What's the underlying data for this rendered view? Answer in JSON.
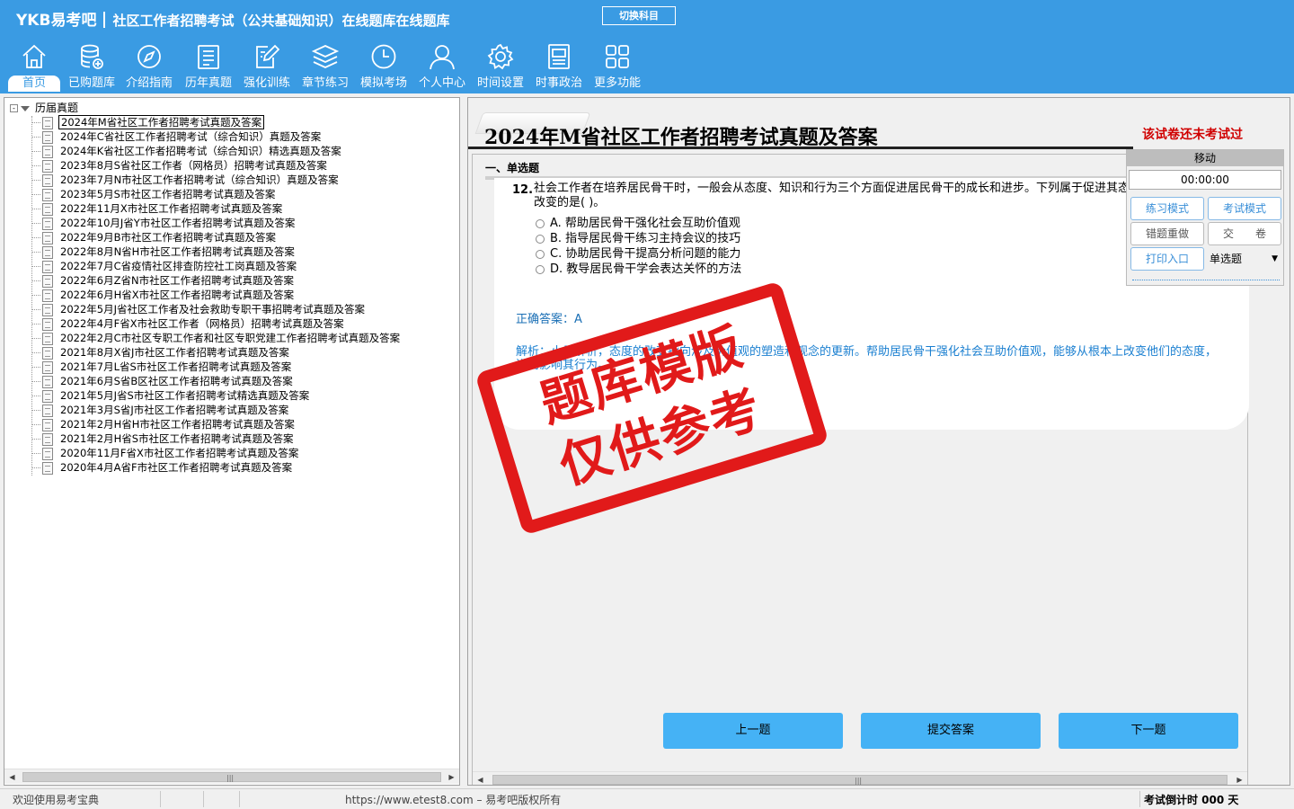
{
  "header": {
    "brand": "YKB易考吧",
    "app_title": "社区工作者招聘考试（公共基础知识）在线题库在线题库",
    "switch_subject_label": "切换科目"
  },
  "nav": [
    {
      "label": "首页",
      "icon": "home-icon"
    },
    {
      "label": "已购题库",
      "icon": "database-icon"
    },
    {
      "label": "介绍指南",
      "icon": "compass-icon"
    },
    {
      "label": "历年真题",
      "icon": "list-doc-icon"
    },
    {
      "label": "强化训练",
      "icon": "edit-icon"
    },
    {
      "label": "章节练习",
      "icon": "layers-icon"
    },
    {
      "label": "模拟考场",
      "icon": "clock-icon"
    },
    {
      "label": "个人中心",
      "icon": "user-icon"
    },
    {
      "label": "时间设置",
      "icon": "gear-icon"
    },
    {
      "label": "时事政治",
      "icon": "news-icon"
    },
    {
      "label": "更多功能",
      "icon": "grid-icon"
    }
  ],
  "tree": {
    "root_label": "历届真题",
    "expander": "-",
    "items": [
      "2024年M省社区工作者招聘考试真题及答案",
      "2024年C省社区工作者招聘考试（综合知识）真题及答案",
      "2024年K省社区工作者招聘考试（综合知识）精选真题及答案",
      "2023年8月S省社区工作者（网格员）招聘考试真题及答案",
      "2023年7月N市社区工作者招聘考试（综合知识）真题及答案",
      "2023年5月S市社区工作者招聘考试真题及答案",
      "2022年11月X市社区工作者招聘考试真题及答案",
      "2022年10月J省Y市社区工作者招聘考试真题及答案",
      "2022年9月B市社区工作者招聘考试真题及答案",
      "2022年8月N省H市社区工作者招聘考试真题及答案",
      "2022年7月C省疫情社区排查防控社工岗真题及答案",
      "2022年6月Z省N市社区工作者招聘考试真题及答案",
      "2022年6月H省X市社区工作者招聘考试真题及答案",
      "2022年5月J省社区工作者及社会救助专职干事招聘考试真题及答案",
      "2022年4月F省X市社区工作者（网格员）招聘考试真题及答案",
      "2022年2月C市社区专职工作者和社区专职党建工作者招聘考试真题及答案",
      "2021年8月X省J市社区工作者招聘考试真题及答案",
      "2021年7月L省S市社区工作者招聘考试真题及答案",
      "2021年6月S省B区社区工作者招聘考试真题及答案",
      "2021年5月J省S市社区工作者招聘考试精选真题及答案",
      "2021年3月S省J市社区工作者招聘考试真题及答案",
      "2021年2月H省H市社区工作者招聘考试真题及答案",
      "2021年2月H省S市社区工作者招聘考试真题及答案",
      "2020年11月F省X市社区工作者招聘考试真题及答案",
      "2020年4月A省F市社区工作者招聘考试真题及答案"
    ]
  },
  "paper": {
    "title": "2024年M省社区工作者招聘考试真题及答案",
    "status": "该试卷还未考试过",
    "section": "一、单选题",
    "question": {
      "number": "12.",
      "text": "社会工作者在培养居民骨干时，一般会从态度、知识和行为三个方面促进居民骨干的成长和进步。下列属于促进其态度改变的是( )。",
      "options": [
        "A. 帮助居民骨干强化社会互助价值观",
        "B. 指导居民骨干练习主持会议的技巧",
        "C. 协助居民骨干提高分析问题的能力",
        "D. 教导居民骨干学会表达关怀的方法"
      ],
      "answer": "正确答案：A",
      "analysis": "解析：小易解析，态度的改变指向涉及价值观的塑造和观念的更新。帮助居民骨干强化社会互助价值观，能够从根本上改变他们的态度，进而影响其行为。"
    }
  },
  "control": {
    "move_label": "移动",
    "timer": "00:00:00",
    "practice_mode": "练习模式",
    "exam_mode": "考试模式",
    "redo_wrong": "错题重做",
    "submit_paper": "交　　卷",
    "print_entry": "打印入口",
    "question_type": "单选题"
  },
  "buttons": {
    "prev": "上一题",
    "submit": "提交答案",
    "next": "下一题"
  },
  "stamp": {
    "line1": "题库模版",
    "line2": "仅供参考",
    "color": "#e11a1a"
  },
  "statusbar": {
    "welcome": "欢迎使用易考宝典",
    "copyright": "https://www.etest8.com – 易考吧版权所有",
    "countdown": "考试倒计时 000 天"
  },
  "colors": {
    "header_bg": "#3a9be3",
    "button_bg": "#45b2f5",
    "status_red": "#d00000",
    "answer_blue": "#1a6fb5"
  }
}
